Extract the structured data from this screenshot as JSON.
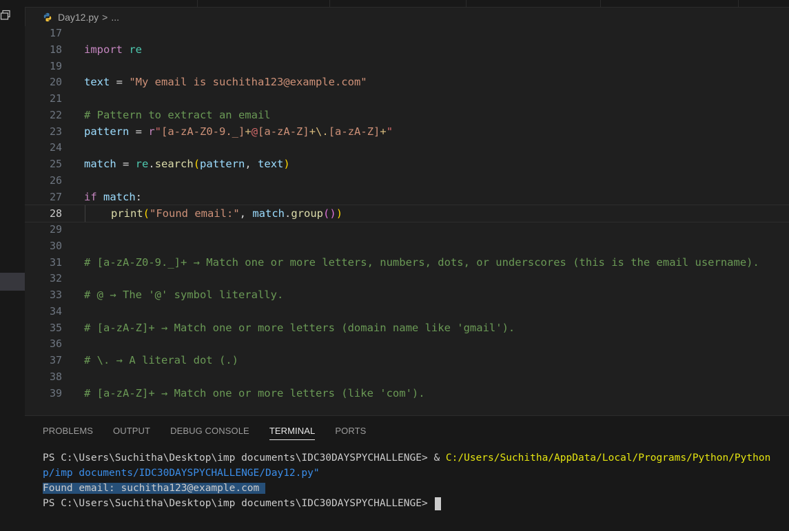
{
  "breadcrumb": {
    "file": "Day12.py",
    "chevron": ">",
    "more": "..."
  },
  "editor": {
    "current_line": "28",
    "lines": [
      {
        "n": "17"
      },
      {
        "n": "18"
      },
      {
        "n": "19"
      },
      {
        "n": "20"
      },
      {
        "n": "21"
      },
      {
        "n": "22"
      },
      {
        "n": "23"
      },
      {
        "n": "24"
      },
      {
        "n": "25"
      },
      {
        "n": "26"
      },
      {
        "n": "27"
      },
      {
        "n": "28"
      },
      {
        "n": "29"
      },
      {
        "n": "30"
      },
      {
        "n": "31"
      },
      {
        "n": "32"
      },
      {
        "n": "33"
      },
      {
        "n": "34"
      },
      {
        "n": "35"
      },
      {
        "n": "36"
      },
      {
        "n": "37"
      },
      {
        "n": "38"
      },
      {
        "n": "39"
      }
    ],
    "code": {
      "l18_kw": "import",
      "l18_mod": " re",
      "l20_var": "text",
      "l20_eq": " = ",
      "l20_str": "\"My email is suchitha123@example.com\"",
      "l22_cm": "# Pattern to extract an email",
      "l23_var": "pattern",
      "l23_eq": " = ",
      "l23_r": "r",
      "l23_q1": "\"",
      "l23_c1": "[a-zA-Z0-9._]",
      "l23_p1": "+",
      "l23_at": "@",
      "l23_c2": "[a-zA-Z]",
      "l23_p2": "+",
      "l23_esc": "\\.",
      "l23_c3": "[a-zA-Z]",
      "l23_p3": "+",
      "l23_q2": "\"",
      "l25_var": "match",
      "l25_eq": " = ",
      "l25_mod": "re",
      "l25_dot": ".",
      "l25_fn": "search",
      "l25_o": "(",
      "l25_a1": "pattern",
      "l25_comma": ", ",
      "l25_a2": "text",
      "l25_c": ")",
      "l27_kw": "if",
      "l27_var": " match",
      "l27_colon": ":",
      "l28_fn": "print",
      "l28_o": "(",
      "l28_str": "\"Found email:\"",
      "l28_comma": ", ",
      "l28_var": "match",
      "l28_dot": ".",
      "l28_fn2": "group",
      "l28_o2": "(",
      "l28_c2": ")",
      "l28_c": ")",
      "l31_cm": "# [a-zA-Z0-9._]+ → Match one or more letters, numbers, dots, or underscores (this is the email username).",
      "l33_cm": "# @ → The '@' symbol literally.",
      "l35_cm": "# [a-zA-Z]+ → Match one or more letters (domain name like 'gmail').",
      "l37_cm": "# \\. → A literal dot (.)",
      "l39_cm": "# [a-zA-Z]+ → Match one or more letters (like 'com')."
    }
  },
  "panel": {
    "tabs": [
      "PROBLEMS",
      "OUTPUT",
      "DEBUG CONSOLE",
      "TERMINAL",
      "PORTS"
    ],
    "active_tab": "TERMINAL",
    "terminal": {
      "prompt1": "PS C:\\Users\\Suchitha\\Desktop\\imp documents\\IDC30DAYSPYCHALLENGE> ",
      "amp": "& ",
      "exe": "C:/Users/Suchitha/AppData/Local/Programs/Python/Python",
      "script_cont": "p/imp documents/IDC30DAYSPYCHALLENGE/Day12.py\"",
      "output": "Found email: suchitha123@example.com ",
      "prompt2": "PS C:\\Users\\Suchitha\\Desktop\\imp documents\\IDC30DAYSPYCHALLENGE> "
    }
  },
  "colors": {
    "background": "#1f1f1f",
    "keyword": "#c586c0",
    "variable": "#9cdcfe",
    "string": "#ce9178",
    "comment": "#6a9955",
    "function": "#dcdcaa",
    "terminal_highlight": "#264f78"
  }
}
